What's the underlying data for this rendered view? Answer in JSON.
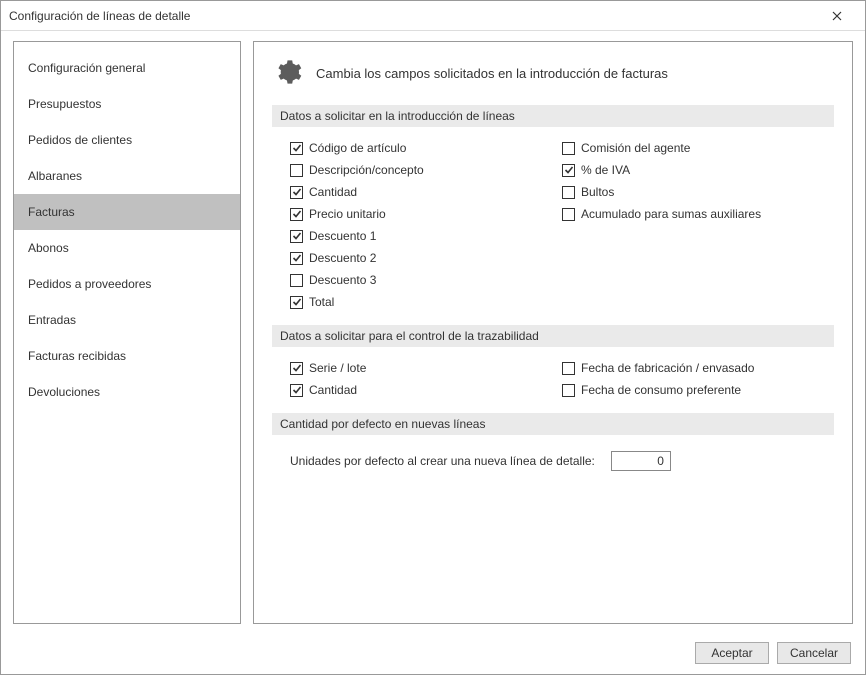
{
  "window": {
    "title": "Configuración de líneas de detalle"
  },
  "sidebar": {
    "items": [
      {
        "label": "Configuración general",
        "selected": false
      },
      {
        "label": "Presupuestos",
        "selected": false
      },
      {
        "label": "Pedidos de clientes",
        "selected": false
      },
      {
        "label": "Albaranes",
        "selected": false
      },
      {
        "label": "Facturas",
        "selected": true
      },
      {
        "label": "Abonos",
        "selected": false
      },
      {
        "label": "Pedidos a proveedores",
        "selected": false
      },
      {
        "label": "Entradas",
        "selected": false
      },
      {
        "label": "Facturas recibidas",
        "selected": false
      },
      {
        "label": "Devoluciones",
        "selected": false
      }
    ]
  },
  "main": {
    "heading": "Cambia los campos solicitados en la introducción de facturas",
    "section1": {
      "title": "Datos a solicitar en la introducción de líneas",
      "left": [
        {
          "label": "Código de artículo",
          "checked": true
        },
        {
          "label": "Descripción/concepto",
          "checked": false
        },
        {
          "label": "Cantidad",
          "checked": true
        },
        {
          "label": "Precio unitario",
          "checked": true
        },
        {
          "label": "Descuento 1",
          "checked": true
        },
        {
          "label": "Descuento 2",
          "checked": true
        },
        {
          "label": "Descuento 3",
          "checked": false
        },
        {
          "label": "Total",
          "checked": true
        }
      ],
      "right": [
        {
          "label": "Comisión del agente",
          "checked": false
        },
        {
          "label": "% de IVA",
          "checked": true
        },
        {
          "label": "Bultos",
          "checked": false
        },
        {
          "label": "Acumulado para sumas auxiliares",
          "checked": false
        }
      ]
    },
    "section2": {
      "title": "Datos a solicitar para el control de la trazabilidad",
      "left": [
        {
          "label": "Serie / lote",
          "checked": true
        },
        {
          "label": "Cantidad",
          "checked": true
        }
      ],
      "right": [
        {
          "label": "Fecha de fabricación / envasado",
          "checked": false
        },
        {
          "label": "Fecha de consumo preferente",
          "checked": false
        }
      ]
    },
    "section3": {
      "title": "Cantidad por defecto en nuevas líneas",
      "prompt": "Unidades por defecto al crear una nueva línea de detalle:",
      "value": "0"
    }
  },
  "buttons": {
    "accept": "Aceptar",
    "cancel": "Cancelar"
  }
}
